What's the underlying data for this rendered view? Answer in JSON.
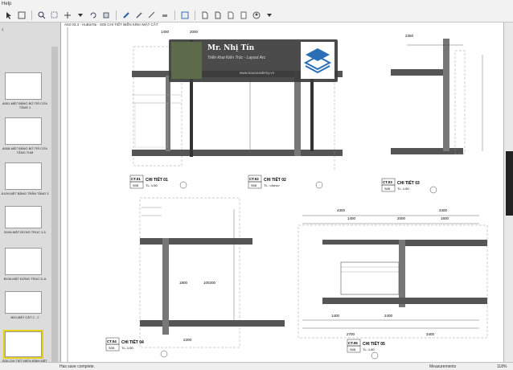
{
  "menu": {
    "help_label": "Help"
  },
  "document": {
    "tab_title": "A03 03.3 - HuBinTai - S05 CHI TIẾT BIỂN KÍNH MẶT CẮT"
  },
  "banner": {
    "name": "Mr. Nhị Tín",
    "subtitle": "Triển khai Kiến Trúc - Layout Arc",
    "url": "www.toucacademy.vn"
  },
  "thumbnails": [
    {
      "label": "A001-MẶT BẰNG BỐ TRÍ CỬA TẦNG 1"
    },
    {
      "label": "A008-MẶT BẰNG BỐ TRÍ CỬA TẦNG TUM"
    },
    {
      "label": "A109-MẶT BẰNG TRẦN TẦNG 3"
    },
    {
      "label": "B106-MẶT ĐỨNG TRỤC 1-5"
    },
    {
      "label": "B106-MẶT ĐỨNG TRỤC D-A"
    },
    {
      "label": "B20-MẶT CẮT 2 - 2"
    },
    {
      "label": "B26-CHI TIẾT BIỂN KÍNH MẶT CẮT"
    }
  ],
  "details": [
    {
      "code": "CT.01",
      "title": "CHI TIẾT 01",
      "sheet": "S05",
      "scale": "TL: 1:50"
    },
    {
      "code": "CT.02",
      "title": "CHI TIẾT 02",
      "sheet": "S05",
      "scale": "TL: <Arno>"
    },
    {
      "code": "CT.03",
      "title": "CHI TIẾT 03",
      "sheet": "S05",
      "scale": "TL: 1:50"
    },
    {
      "code": "CT.04",
      "title": "CHI TIẾT 04",
      "sheet": "S05",
      "scale": "TL: 1:50"
    },
    {
      "code": "CT.05",
      "title": "CHI TIẾT 05",
      "sheet": "S05",
      "scale": "TL: 1:50"
    }
  ],
  "dims": {
    "d1400": "1400",
    "d2000": "2000",
    "d4300": "4300",
    "d3400": "3400",
    "d2700": "2700",
    "d1800": "1800",
    "d100200": "100200",
    "d2200": "2200",
    "d2350": "2350",
    "d3150": "3150",
    "d2400": "2400",
    "d1600": "1600"
  },
  "status": {
    "left": "Has save complete.",
    "measurements": "Measurements",
    "zoom": "118%"
  }
}
